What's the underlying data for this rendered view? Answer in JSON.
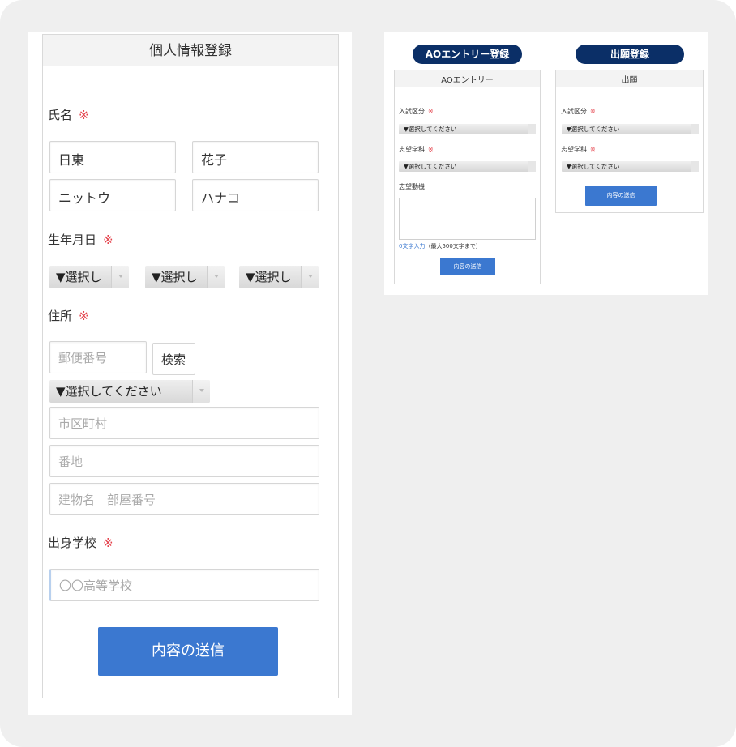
{
  "registration_form": {
    "title": "個人情報登録",
    "name_label": "氏名",
    "required_mark": "※",
    "last_name": "日東",
    "first_name": "花子",
    "last_name_kana": "ニットウ",
    "first_name_kana": "ハナコ",
    "birthdate_label": "生年月日",
    "birth_year_select": "▼選択し",
    "birth_month_select": "▼選択し",
    "birth_day_select": "▼選択し",
    "address_label": "住所",
    "postal_placeholder": "郵便番号",
    "search_button": "検索",
    "prefecture_select": "▼選択してください",
    "city_placeholder": "市区町村",
    "street_placeholder": "番地",
    "building_placeholder": "建物名　部屋番号",
    "school_label": "出身学校",
    "school_placeholder": "〇〇高等学校",
    "submit_button": "内容の送信"
  },
  "ao_entry": {
    "pill_label": "AOエントリー登録",
    "card_title": "AOエントリー",
    "exam_category_label": "入試区分",
    "exam_category_select": "▼選択してください",
    "department_label": "志望学科",
    "department_select": "▼選択してください",
    "motivation_label": "志望動機",
    "char_count": "0文字入力",
    "char_limit": "（最大500文字まで）",
    "submit_button": "内容の送信",
    "required_mark": "※"
  },
  "application": {
    "pill_label": "出願登録",
    "card_title": "出願",
    "exam_category_label": "入試区分",
    "exam_category_select": "▼選択してください",
    "department_label": "志望学科",
    "department_select": "▼選択してください",
    "submit_button": "内容の送信",
    "required_mark": "※"
  },
  "colors": {
    "accent_blue": "#3b78d0",
    "pill_navy": "#0b2f67",
    "required_red": "#e4404a"
  }
}
